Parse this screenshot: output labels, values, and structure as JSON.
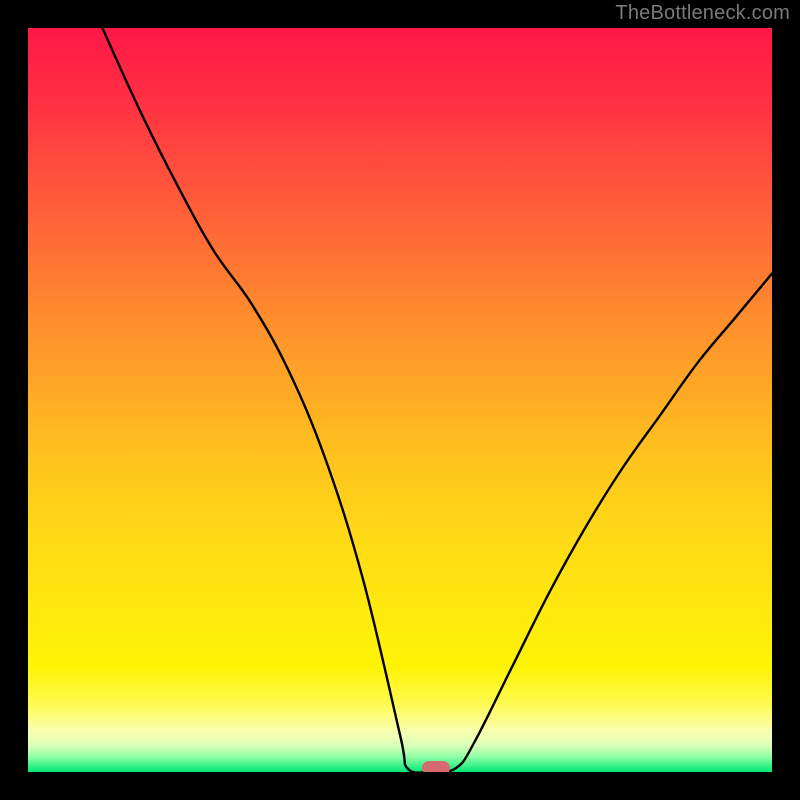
{
  "watermark": "TheBottleneck.com",
  "marker": {
    "x_pct": 54.8,
    "y_pct": 99.5,
    "color": "#d46a6e"
  },
  "chart_data": {
    "type": "line",
    "title": "",
    "xlabel": "",
    "ylabel": "",
    "xlim": [
      0,
      100
    ],
    "ylim": [
      0,
      100
    ],
    "grid": false,
    "series": [
      {
        "name": "bottleneck-curve",
        "x": [
          10.0,
          15.0,
          20.0,
          25.0,
          30.0,
          35.0,
          40.0,
          45.0,
          50.0,
          51.0,
          54.0,
          57.5,
          60.0,
          65.0,
          70.0,
          75.0,
          80.0,
          85.0,
          90.0,
          95.0,
          100.0
        ],
        "y": [
          100.0,
          89.0,
          79.0,
          70.0,
          63.0,
          54.0,
          42.0,
          26.0,
          5.0,
          0.5,
          0.0,
          0.5,
          4.0,
          14.0,
          24.0,
          33.0,
          41.0,
          48.0,
          55.0,
          61.0,
          67.0
        ]
      }
    ],
    "note": "x is horizontal position in percent of plot width; y is V-shaped curve height in percent of plot height from bottom; curve minimum near x≈54"
  }
}
